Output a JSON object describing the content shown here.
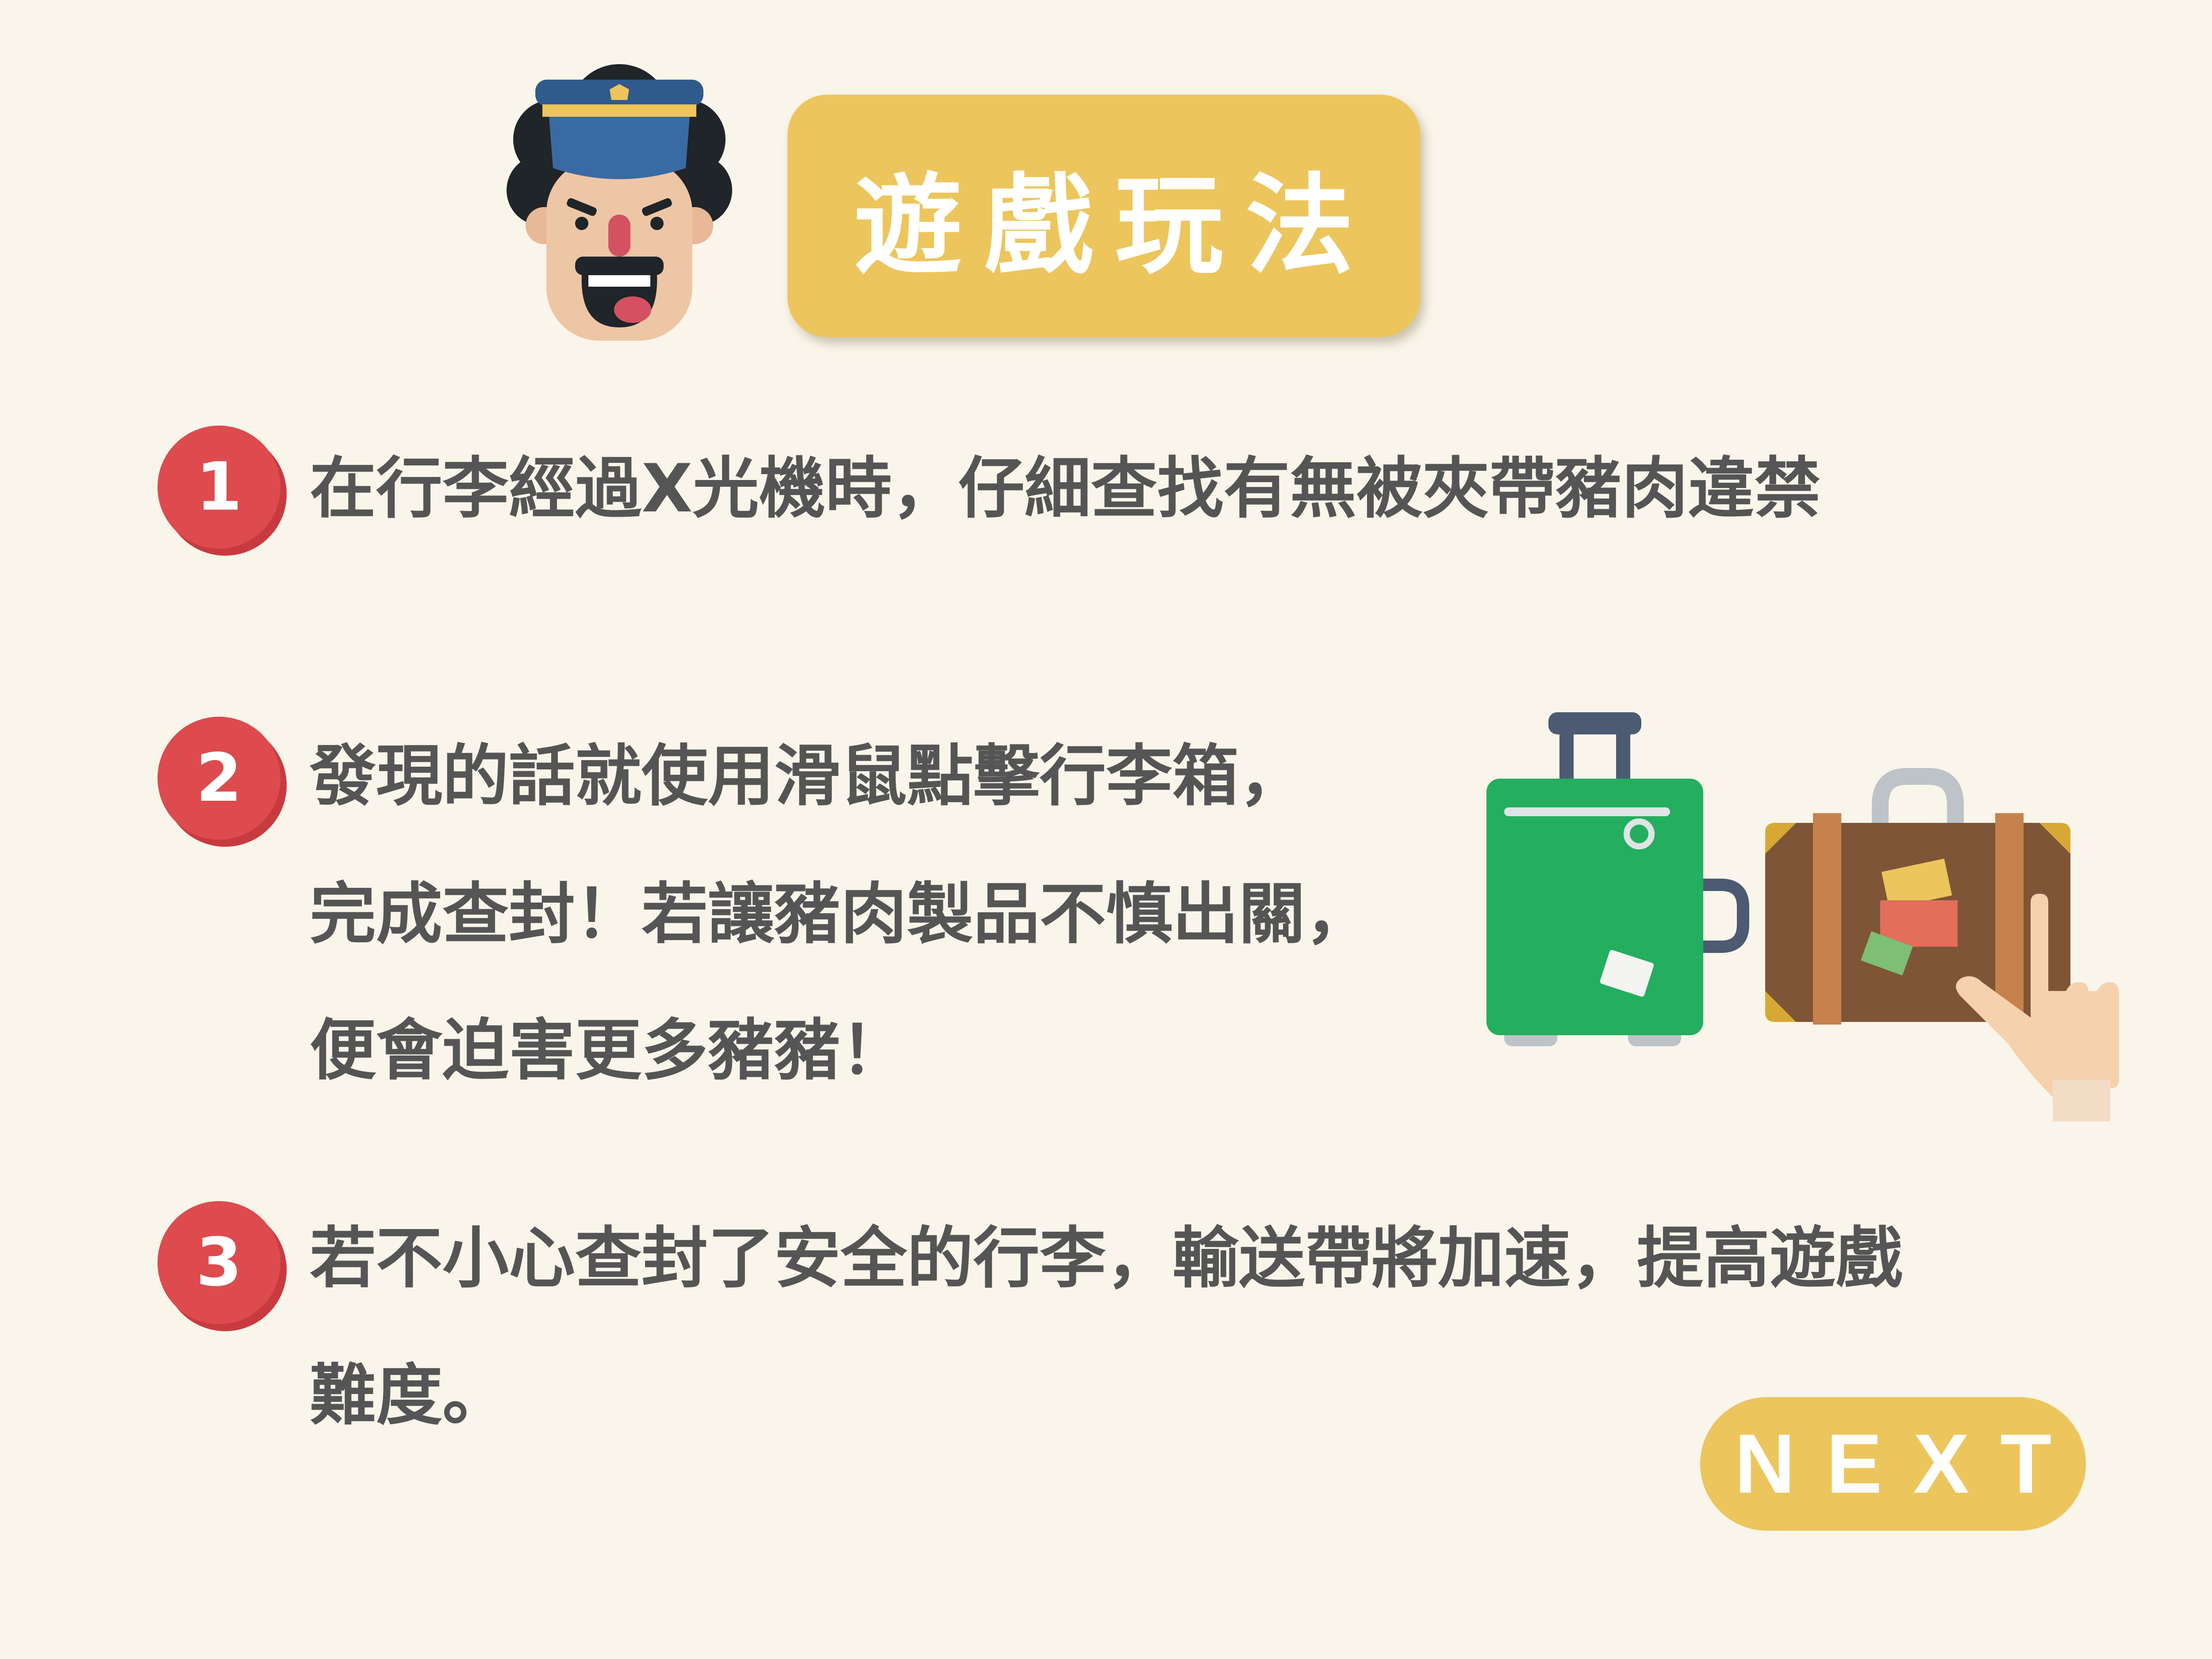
{
  "title": "遊戲玩法",
  "steps": [
    {
      "number": "1",
      "lines": [
        "在行李經過X光機時，仔細查找有無被夾帶豬肉違禁"
      ]
    },
    {
      "number": "2",
      "lines": [
        "發現的話就使用滑鼠點擊行李箱，",
        "完成查封！若讓豬肉製品不慎出關，",
        "便會迫害更多豬豬！"
      ]
    },
    {
      "number": "3",
      "lines": [
        "若不小心查封了安全的行李，輸送帶將加速，提高遊戲",
        "難度。"
      ]
    }
  ],
  "next_button": {
    "label": "NEXT"
  },
  "icons": {
    "officer": "customs-officer-icon",
    "green_suitcase": "green-suitcase-icon",
    "brown_suitcase": "brown-suitcase-icon",
    "hand": "pointing-hand-icon"
  },
  "colors": {
    "background": "#f9f5ea",
    "accent": "#ecc55c",
    "badge": "#dd4b4e",
    "text": "#555555"
  }
}
